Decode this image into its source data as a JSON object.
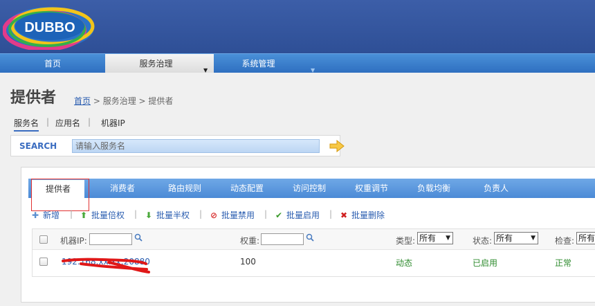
{
  "logo": {
    "text": "DUBBO"
  },
  "nav": [
    {
      "label": "首页",
      "active": false
    },
    {
      "label": "服务治理",
      "active": true,
      "arrow": "▼"
    },
    {
      "label": "系统管理",
      "active": false,
      "arrow": "▼"
    }
  ],
  "page": {
    "title": "提供者"
  },
  "breadcrumb": {
    "home": "首页",
    "rest": " > 服务治理 > 提供者"
  },
  "subtabs": [
    {
      "label": "服务名",
      "active": true
    },
    {
      "label": "应用名",
      "active": false
    },
    {
      "label": "机器IP",
      "active": false
    }
  ],
  "search": {
    "label": "SEARCH",
    "placeholder": "请输入服务名"
  },
  "tabs": [
    {
      "label": "提供者",
      "active": true
    },
    {
      "label": "消费者"
    },
    {
      "label": "路由规则"
    },
    {
      "label": "动态配置"
    },
    {
      "label": "访问控制"
    },
    {
      "label": "权重调节"
    },
    {
      "label": "负载均衡"
    },
    {
      "label": "负责人"
    }
  ],
  "toolbar": [
    {
      "label": "新增",
      "icon": "add-icon"
    },
    {
      "label": "批量倍权",
      "icon": "double-weight-icon"
    },
    {
      "label": "批量半权",
      "icon": "half-weight-icon"
    },
    {
      "label": "批量禁用",
      "icon": "disable-icon"
    },
    {
      "label": "批量启用",
      "icon": "enable-icon"
    },
    {
      "label": "批量删除",
      "icon": "delete-icon"
    }
  ],
  "table": {
    "headers": {
      "ip": "机器IP:",
      "weight": "权重:",
      "type": "类型:",
      "status": "状态:",
      "check": "检查:"
    },
    "filters": {
      "type": "所有",
      "status": "所有",
      "check": "所有"
    },
    "rows": [
      {
        "address": "192.168.xx.xx:20880",
        "weight": "100",
        "type": "动态",
        "status": "已启用",
        "check": "正常"
      }
    ]
  },
  "colors": {
    "accent": "#2a5db0",
    "header": "#3c5ea8",
    "ok": "#2e8b2e",
    "redact": "#e01818"
  }
}
